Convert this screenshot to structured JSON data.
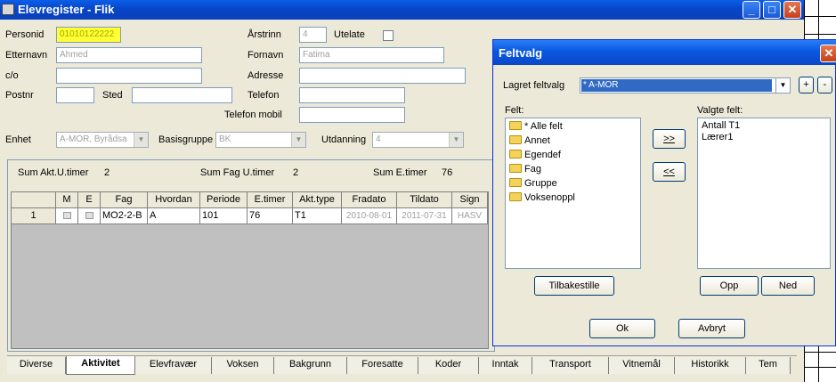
{
  "window": {
    "title": "Elevregister - Flik",
    "minimize": "_",
    "maximize": "□",
    "close": "✕"
  },
  "form": {
    "personid_label": "Personid",
    "personid_value": "01010122222",
    "etternavn_label": "Etternavn",
    "etternavn_value": "Ahmed",
    "co_label": "c/o",
    "co_value": "",
    "postnr_label": "Postnr",
    "postnr_value": "",
    "sted_label": "Sted",
    "sted_value": "",
    "arstrinn_label": "Årstrinn",
    "arstrinn_value": "4",
    "utelate_label": "Utelate",
    "fornavn_label": "Fornavn",
    "fornavn_value": "Fatima",
    "adresse_label": "Adresse",
    "adresse_value": "",
    "telefon_label": "Telefon",
    "telefon_value": "",
    "telefon_mobil_label": "Telefon mobil",
    "telefon_mobil_value": "",
    "enhet_label": "Enhet",
    "enhet_value": "A-MOR, Byrådsa",
    "basisgruppe_label": "Basisgruppe",
    "basisgruppe_value": "BK",
    "utdanning_label": "Utdanning",
    "utdanning_value": "4"
  },
  "summary": {
    "sum_akt_label": "Sum Akt.U.timer",
    "sum_akt_value": "2",
    "sum_fag_label": "Sum Fag U.timer",
    "sum_fag_value": "2",
    "sum_e_label": "Sum E.timer",
    "sum_e_value": "76"
  },
  "grid": {
    "headers": [
      "",
      "M",
      "E",
      "Fag",
      "Hvordan",
      "Periode",
      "E.timer",
      "Akt.type",
      "Fradato",
      "Tildato",
      "Sign"
    ],
    "rows": [
      {
        "num": "1",
        "fag": "MO2-2-B",
        "hvordan": "A",
        "periode": "101",
        "etimer": "76",
        "akttype": "T1",
        "fradato": "2010-08-01",
        "tildato": "2011-07-31",
        "sign": "HASV"
      }
    ]
  },
  "tabs": [
    "Diverse",
    "Aktivitet",
    "Elevfravær",
    "Voksen",
    "Bakgrunn",
    "Foresatte",
    "Koder",
    "Inntak",
    "Transport",
    "Vitnemål",
    "Historikk",
    "Tem"
  ],
  "dialog": {
    "title": "Feltvalg",
    "close": "✕",
    "lagret_label": "Lagret feltvalg",
    "lagret_value": "* A-MOR",
    "plus": "+",
    "minus": "-",
    "felt_label": "Felt:",
    "felt_items": [
      "* Alle felt",
      "Annet",
      "Egendef",
      "Fag",
      "Gruppe",
      "Voksenoppl"
    ],
    "valgte_label": "Valgte felt:",
    "valgte_items": [
      "Antall T1",
      "Lærer1"
    ],
    "add_btn": ">>",
    "remove_btn": "<<",
    "tilbakestille": "Tilbakestille",
    "opp": "Opp",
    "ned": "Ned",
    "ok": "Ok",
    "avbryt": "Avbryt"
  }
}
